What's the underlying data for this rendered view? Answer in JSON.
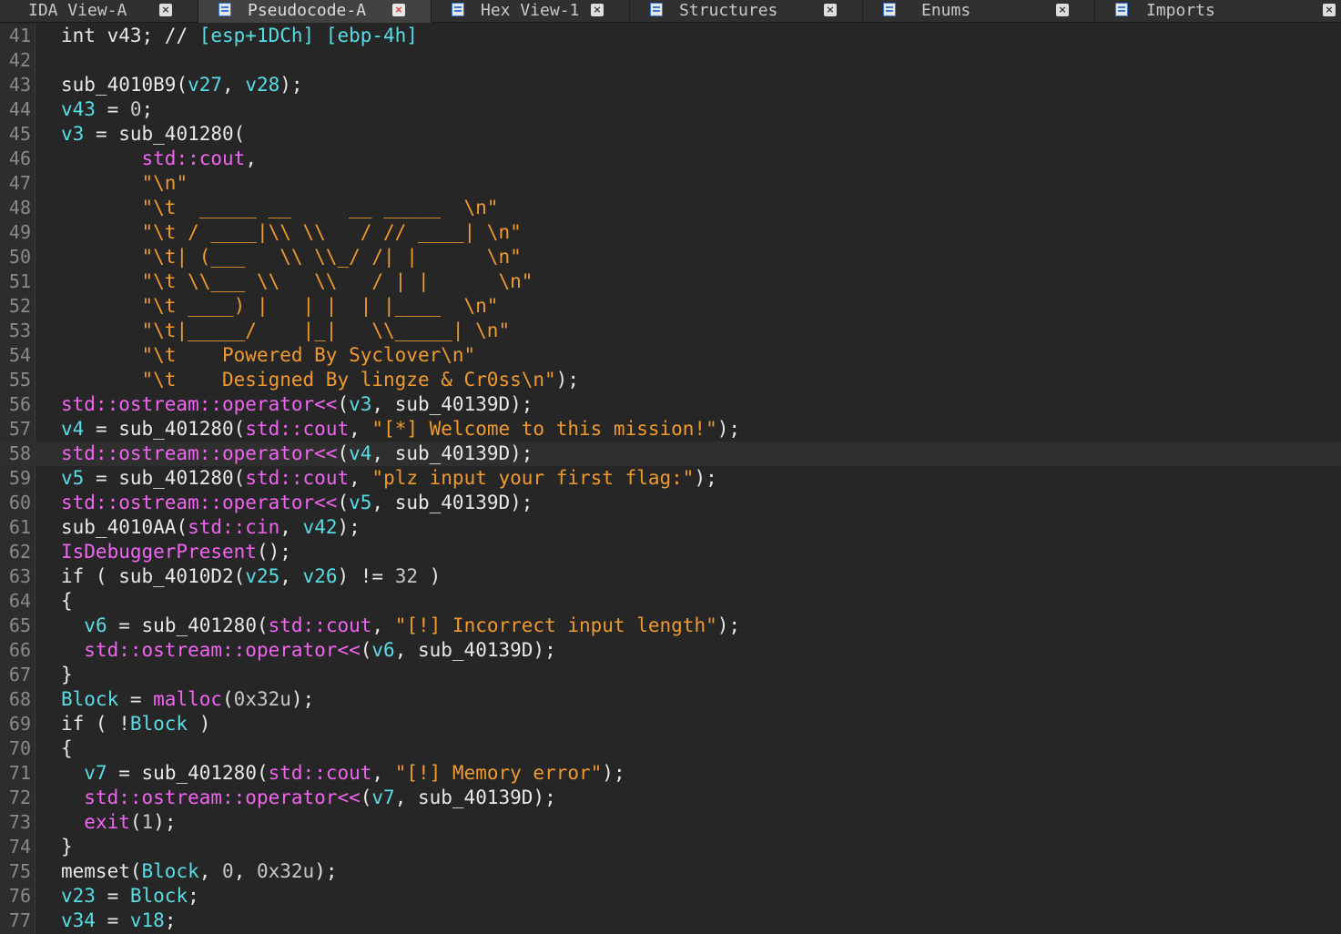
{
  "tabs": [
    {
      "label": "IDA View-A",
      "active": false,
      "close": "×"
    },
    {
      "label": "Pseudocode-A",
      "active": true,
      "close": "×"
    },
    {
      "label": "Hex View-1",
      "active": false,
      "close": "×"
    },
    {
      "label": "Structures",
      "active": false,
      "close": "×"
    },
    {
      "label": "Enums",
      "active": false,
      "close": "×"
    },
    {
      "label": "Imports",
      "active": false,
      "close": "×"
    }
  ],
  "current_line": 58,
  "colors": {
    "background": "#262626",
    "plain": "#e8e8e8",
    "identifier": "#58dce6",
    "function": "#f064f0",
    "string": "#f09a2e",
    "number": "#c8c8c8",
    "line_number": "#8a8a8a"
  },
  "lines": [
    {
      "n": "41",
      "t": [
        [
          "int ",
          "pl"
        ],
        [
          "v43",
          "pl"
        ],
        [
          "; // ",
          "pl"
        ],
        [
          "[esp+1DCh] [ebp-4h]",
          "id"
        ]
      ]
    },
    {
      "n": "42",
      "t": []
    },
    {
      "n": "43",
      "t": [
        [
          "sub_4010B9",
          "pl"
        ],
        [
          "(",
          "pl"
        ],
        [
          "v27",
          "id"
        ],
        [
          ", ",
          "pl"
        ],
        [
          "v28",
          "id"
        ],
        [
          ");",
          "pl"
        ]
      ]
    },
    {
      "n": "44",
      "t": [
        [
          "v43",
          "id"
        ],
        [
          " = ",
          "pl"
        ],
        [
          "0",
          "num"
        ],
        [
          ";",
          "pl"
        ]
      ]
    },
    {
      "n": "45",
      "t": [
        [
          "v3",
          "id"
        ],
        [
          " = ",
          "pl"
        ],
        [
          "sub_401280",
          "pl"
        ],
        [
          "(",
          "pl"
        ]
      ]
    },
    {
      "n": "46",
      "t": [
        [
          "       ",
          "pl"
        ],
        [
          "std::cout",
          "fn"
        ],
        [
          ",",
          "pl"
        ]
      ]
    },
    {
      "n": "47",
      "t": [
        [
          "       ",
          "pl"
        ],
        [
          "\"\\n\"",
          "str"
        ]
      ]
    },
    {
      "n": "48",
      "t": [
        [
          "       ",
          "pl"
        ],
        [
          "\"\\t  _____ __     __ _____  \\n\"",
          "str"
        ]
      ]
    },
    {
      "n": "49",
      "t": [
        [
          "       ",
          "pl"
        ],
        [
          "\"\\t / ____|\\\\ \\\\   / // ____| \\n\"",
          "str"
        ]
      ]
    },
    {
      "n": "50",
      "t": [
        [
          "       ",
          "pl"
        ],
        [
          "\"\\t| (___   \\\\ \\\\_/ /| |      \\n\"",
          "str"
        ]
      ]
    },
    {
      "n": "51",
      "t": [
        [
          "       ",
          "pl"
        ],
        [
          "\"\\t \\\\___ \\\\   \\\\   / | |      \\n\"",
          "str"
        ]
      ]
    },
    {
      "n": "52",
      "t": [
        [
          "       ",
          "pl"
        ],
        [
          "\"\\t ____) |   | |  | |____  \\n\"",
          "str"
        ]
      ]
    },
    {
      "n": "53",
      "t": [
        [
          "       ",
          "pl"
        ],
        [
          "\"\\t|_____/    |_|   \\\\_____| \\n\"",
          "str"
        ]
      ]
    },
    {
      "n": "54",
      "t": [
        [
          "       ",
          "pl"
        ],
        [
          "\"\\t    Powered By Syclover\\n\"",
          "str"
        ]
      ]
    },
    {
      "n": "55",
      "t": [
        [
          "       ",
          "pl"
        ],
        [
          "\"\\t    Designed By lingze & Cr0ss\\n\"",
          "str"
        ],
        [
          ");",
          "pl"
        ]
      ]
    },
    {
      "n": "56",
      "t": [
        [
          "std::ostream::operator<<",
          "fn"
        ],
        [
          "(",
          "pl"
        ],
        [
          "v3",
          "id"
        ],
        [
          ", ",
          "pl"
        ],
        [
          "sub_40139D",
          "pl"
        ],
        [
          ");",
          "pl"
        ]
      ]
    },
    {
      "n": "57",
      "t": [
        [
          "v4",
          "id"
        ],
        [
          " = ",
          "pl"
        ],
        [
          "sub_401280",
          "pl"
        ],
        [
          "(",
          "pl"
        ],
        [
          "std::cout",
          "fn"
        ],
        [
          ", ",
          "pl"
        ],
        [
          "\"[*] Welcome to this mission!\"",
          "str"
        ],
        [
          ");",
          "pl"
        ]
      ]
    },
    {
      "n": "58",
      "t": [
        [
          "std::ostream::operator<<",
          "fn"
        ],
        [
          "(",
          "pl"
        ],
        [
          "v4",
          "id"
        ],
        [
          ", ",
          "pl"
        ],
        [
          "sub_40139D",
          "pl"
        ],
        [
          ");",
          "pl"
        ]
      ]
    },
    {
      "n": "59",
      "t": [
        [
          "v5",
          "id"
        ],
        [
          " = ",
          "pl"
        ],
        [
          "sub_401280",
          "pl"
        ],
        [
          "(",
          "pl"
        ],
        [
          "std::cout",
          "fn"
        ],
        [
          ", ",
          "pl"
        ],
        [
          "\"plz input your first flag:\"",
          "str"
        ],
        [
          ");",
          "pl"
        ]
      ]
    },
    {
      "n": "60",
      "t": [
        [
          "std::ostream::operator<<",
          "fn"
        ],
        [
          "(",
          "pl"
        ],
        [
          "v5",
          "id"
        ],
        [
          ", ",
          "pl"
        ],
        [
          "sub_40139D",
          "pl"
        ],
        [
          ");",
          "pl"
        ]
      ]
    },
    {
      "n": "61",
      "t": [
        [
          "sub_4010AA",
          "pl"
        ],
        [
          "(",
          "pl"
        ],
        [
          "std::cin",
          "fn"
        ],
        [
          ", ",
          "pl"
        ],
        [
          "v42",
          "id"
        ],
        [
          ");",
          "pl"
        ]
      ]
    },
    {
      "n": "62",
      "t": [
        [
          "IsDebuggerPresent",
          "fn"
        ],
        [
          "();",
          "pl"
        ]
      ]
    },
    {
      "n": "63",
      "t": [
        [
          "if ( ",
          "pl"
        ],
        [
          "sub_4010D2",
          "pl"
        ],
        [
          "(",
          "pl"
        ],
        [
          "v25",
          "id"
        ],
        [
          ", ",
          "pl"
        ],
        [
          "v26",
          "id"
        ],
        [
          ") != ",
          "pl"
        ],
        [
          "32",
          "num"
        ],
        [
          " )",
          "pl"
        ]
      ]
    },
    {
      "n": "64",
      "t": [
        [
          "{",
          "pl"
        ]
      ]
    },
    {
      "n": "65",
      "t": [
        [
          "  ",
          "pl"
        ],
        [
          "v6",
          "id"
        ],
        [
          " = ",
          "pl"
        ],
        [
          "sub_401280",
          "pl"
        ],
        [
          "(",
          "pl"
        ],
        [
          "std::cout",
          "fn"
        ],
        [
          ", ",
          "pl"
        ],
        [
          "\"[!] Incorrect input length\"",
          "str"
        ],
        [
          ");",
          "pl"
        ]
      ]
    },
    {
      "n": "66",
      "t": [
        [
          "  ",
          "pl"
        ],
        [
          "std::ostream::operator<<",
          "fn"
        ],
        [
          "(",
          "pl"
        ],
        [
          "v6",
          "id"
        ],
        [
          ", ",
          "pl"
        ],
        [
          "sub_40139D",
          "pl"
        ],
        [
          ");",
          "pl"
        ]
      ]
    },
    {
      "n": "67",
      "t": [
        [
          "}",
          "pl"
        ]
      ]
    },
    {
      "n": "68",
      "t": [
        [
          "Block",
          "id"
        ],
        [
          " = ",
          "pl"
        ],
        [
          "malloc",
          "fn"
        ],
        [
          "(",
          "pl"
        ],
        [
          "0x32u",
          "num"
        ],
        [
          ");",
          "pl"
        ]
      ]
    },
    {
      "n": "69",
      "t": [
        [
          "if ( !",
          "pl"
        ],
        [
          "Block",
          "id"
        ],
        [
          " )",
          "pl"
        ]
      ]
    },
    {
      "n": "70",
      "t": [
        [
          "{",
          "pl"
        ]
      ]
    },
    {
      "n": "71",
      "t": [
        [
          "  ",
          "pl"
        ],
        [
          "v7",
          "id"
        ],
        [
          " = ",
          "pl"
        ],
        [
          "sub_401280",
          "pl"
        ],
        [
          "(",
          "pl"
        ],
        [
          "std::cout",
          "fn"
        ],
        [
          ", ",
          "pl"
        ],
        [
          "\"[!] Memory error\"",
          "str"
        ],
        [
          ");",
          "pl"
        ]
      ]
    },
    {
      "n": "72",
      "t": [
        [
          "  ",
          "pl"
        ],
        [
          "std::ostream::operator<<",
          "fn"
        ],
        [
          "(",
          "pl"
        ],
        [
          "v7",
          "id"
        ],
        [
          ", ",
          "pl"
        ],
        [
          "sub_40139D",
          "pl"
        ],
        [
          ");",
          "pl"
        ]
      ]
    },
    {
      "n": "73",
      "t": [
        [
          "  ",
          "pl"
        ],
        [
          "exit",
          "fn"
        ],
        [
          "(",
          "pl"
        ],
        [
          "1",
          "num"
        ],
        [
          ");",
          "pl"
        ]
      ]
    },
    {
      "n": "74",
      "t": [
        [
          "}",
          "pl"
        ]
      ]
    },
    {
      "n": "75",
      "t": [
        [
          "memset",
          "pl"
        ],
        [
          "(",
          "pl"
        ],
        [
          "Block",
          "id"
        ],
        [
          ", ",
          "pl"
        ],
        [
          "0",
          "num"
        ],
        [
          ", ",
          "pl"
        ],
        [
          "0x32u",
          "num"
        ],
        [
          ");",
          "pl"
        ]
      ]
    },
    {
      "n": "76",
      "t": [
        [
          "v23",
          "id"
        ],
        [
          " = ",
          "pl"
        ],
        [
          "Block",
          "id"
        ],
        [
          ";",
          "pl"
        ]
      ]
    },
    {
      "n": "77",
      "t": [
        [
          "v34",
          "id"
        ],
        [
          " = ",
          "pl"
        ],
        [
          "v18",
          "id"
        ],
        [
          ";",
          "pl"
        ]
      ]
    }
  ]
}
